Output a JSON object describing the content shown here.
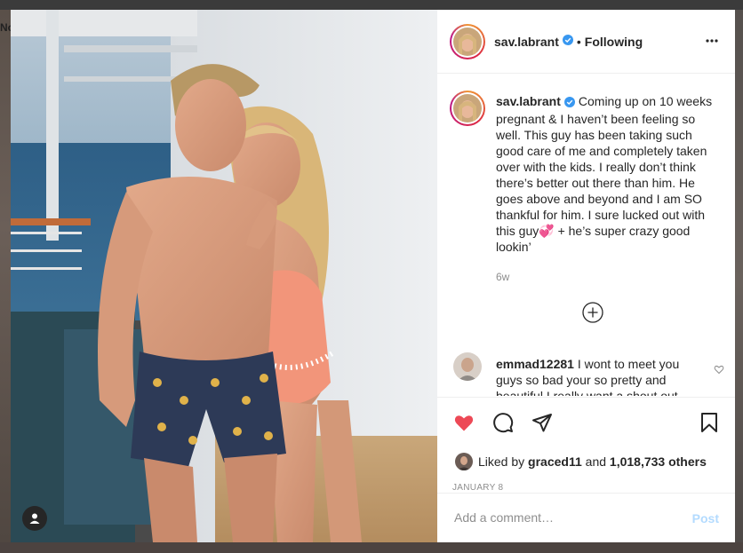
{
  "background": {
    "partial_text": "No"
  },
  "post": {
    "username": "sav.labrant",
    "follow_status": "Following",
    "caption": "Coming up on 10 weeks pregnant & I haven’t been feeling so well. This guy has been taking such good care of me and completely taken over with the kids. I really don’t think there’s better out there than him. He goes above and beyond and I am SO thankful for him. I sure lucked out with this guy💞 + he’s super crazy good lookin’",
    "time_ago": "6w",
    "date": "JANUARY 8",
    "likes": {
      "prefix": "Liked by",
      "by_user": "graced11",
      "and_word": "and",
      "others": "1,018,733 others"
    }
  },
  "comments": [
    {
      "username": "emmad12281",
      "text": "I wont to meet you guys so bad your so pretty and beautiful I really want a shout out"
    }
  ],
  "add_comment": {
    "placeholder": "Add a comment…",
    "post_label": "Post"
  },
  "icons": {
    "like": "heart-filled-icon",
    "comment": "comment-bubble-icon",
    "share": "paper-plane-icon",
    "save": "bookmark-icon",
    "more": "more-dots-icon",
    "load_more": "plus-circle-icon",
    "user_tags": "user-icon",
    "verified": "verified-badge-icon"
  },
  "colors": {
    "like_red": "#ed4956",
    "verified_blue": "#3897f0",
    "post_disabled": "#b3dbff",
    "secondary_text": "#8e8e8e"
  }
}
